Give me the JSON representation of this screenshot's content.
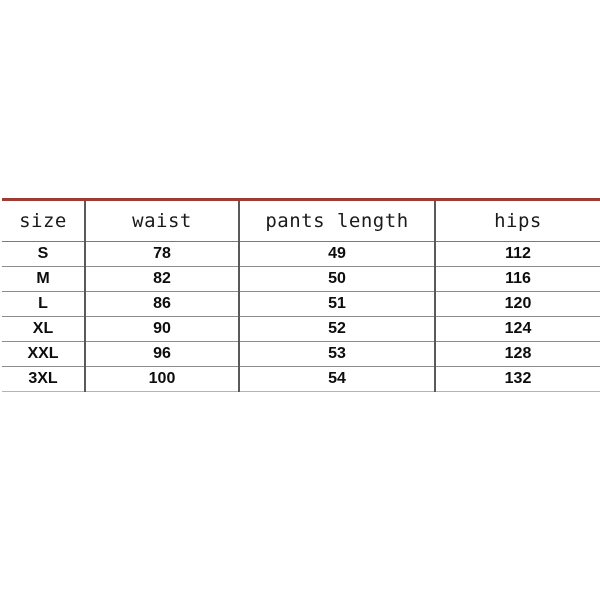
{
  "page": {
    "background_color": "#ffffff",
    "table_top_rule_color": "#9e3b33",
    "grid_line_color": "#8d8d8d",
    "divider_color": "#5a5a5a",
    "text_color": "#111111"
  },
  "size_chart": {
    "columns": [
      {
        "key": "size",
        "label": "size"
      },
      {
        "key": "waist",
        "label": "waist"
      },
      {
        "key": "pants_length",
        "label": "pants length"
      },
      {
        "key": "hips",
        "label": "hips"
      }
    ],
    "rows": [
      {
        "size": "S",
        "waist": "78",
        "pants_length": "49",
        "hips": "112"
      },
      {
        "size": "M",
        "waist": "82",
        "pants_length": "50",
        "hips": "116"
      },
      {
        "size": "L",
        "waist": "86",
        "pants_length": "51",
        "hips": "120"
      },
      {
        "size": "XL",
        "waist": "90",
        "pants_length": "52",
        "hips": "124"
      },
      {
        "size": "XXL",
        "waist": "96",
        "pants_length": "53",
        "hips": "128"
      },
      {
        "size": "3XL",
        "waist": "100",
        "pants_length": "54",
        "hips": "132"
      }
    ]
  },
  "chart_data": {
    "type": "table",
    "title": "",
    "columns": [
      "size",
      "waist",
      "pants length",
      "hips"
    ],
    "rows": [
      [
        "S",
        78,
        49,
        112
      ],
      [
        "M",
        82,
        50,
        116
      ],
      [
        "L",
        86,
        51,
        120
      ],
      [
        "XL",
        90,
        52,
        124
      ],
      [
        "XXL",
        96,
        53,
        128
      ],
      [
        "3XL",
        100,
        54,
        132
      ]
    ],
    "series": [
      {
        "name": "waist",
        "categories": [
          "S",
          "M",
          "L",
          "XL",
          "XXL",
          "3XL"
        ],
        "values": [
          78,
          82,
          86,
          90,
          96,
          100
        ]
      },
      {
        "name": "pants length",
        "categories": [
          "S",
          "M",
          "L",
          "XL",
          "XXL",
          "3XL"
        ],
        "values": [
          49,
          50,
          51,
          52,
          53,
          54
        ]
      },
      {
        "name": "hips",
        "categories": [
          "S",
          "M",
          "L",
          "XL",
          "XXL",
          "3XL"
        ],
        "values": [
          112,
          116,
          120,
          124,
          128,
          132
        ]
      }
    ]
  }
}
